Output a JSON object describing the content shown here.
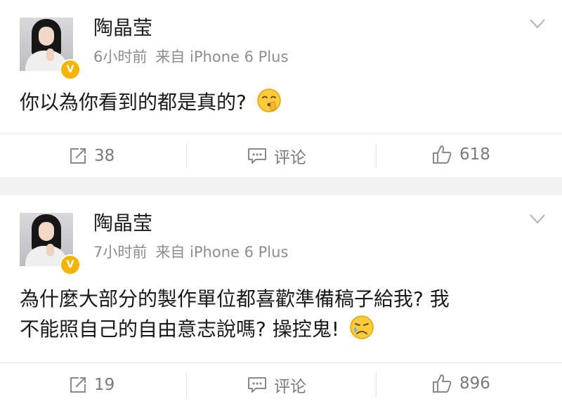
{
  "posts": [
    {
      "author": "陶晶莹",
      "time": "6小时前",
      "source": "来自 iPhone 6 Plus",
      "verified_badge": "V",
      "content_lines": [
        "你以為你看到的都是真的?"
      ],
      "emoji": "shush-face-emoji",
      "repost_count": "38",
      "comment_label": "评论",
      "like_count": "618"
    },
    {
      "author": "陶晶莹",
      "time": "7小时前",
      "source": "来自 iPhone 6 Plus",
      "verified_badge": "V",
      "content_lines": [
        "為什麼大部分的製作單位都喜歡準備稿子給我? 我",
        "不能照自己的自由意志說嗎? 操控鬼!"
      ],
      "emoji": "sad-face-emoji",
      "repost_count": "19",
      "comment_label": "评论",
      "like_count": "896"
    }
  ],
  "colors": {
    "badge": "#f4b400",
    "meta_text": "#8e8e8e",
    "action_text": "#7a7a7a",
    "separator_band": "#f2f2f2"
  },
  "icons": {
    "repost": "repost-icon",
    "comment": "comment-icon",
    "like": "thumbs-up-icon",
    "menu": "chevron-down-icon"
  }
}
